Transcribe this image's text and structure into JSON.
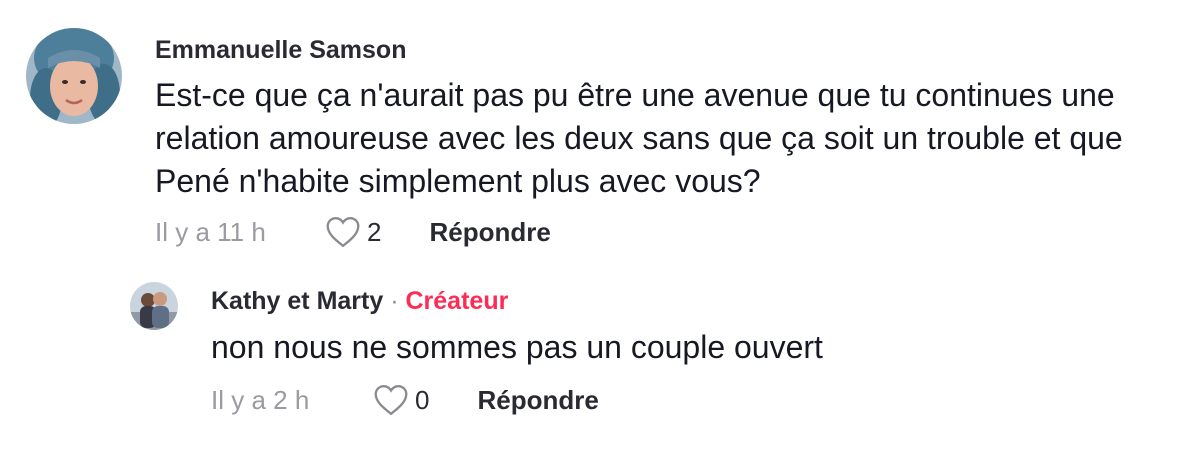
{
  "comments": [
    {
      "author": "Emmanuelle Samson",
      "avatar_icon": "avatar-woman-blue-headscarf",
      "text": "Est-ce que ça n'aurait pas pu être une avenue que tu continues une relation amoureuse avec les deux sans que ça soit un trouble et que Pené n'habite simplement plus avec vous?",
      "time": "Il y a 11 h",
      "like_icon": "heart-outline-icon",
      "likes": "2",
      "reply_label": "Répondre"
    }
  ],
  "replies": [
    {
      "author": "Kathy et Marty",
      "separator": "·",
      "creator_label": "Créateur",
      "avatar_icon": "avatar-couple-photo",
      "text": "non nous ne sommes pas un couple ouvert",
      "time": "Il y a 2 h",
      "like_icon": "heart-outline-icon",
      "likes": "0",
      "reply_label": "Répondre"
    }
  ],
  "colors": {
    "creator_accent": "#fe2c55",
    "meta_gray": "#9a9ba0",
    "text_dark": "#161823"
  }
}
